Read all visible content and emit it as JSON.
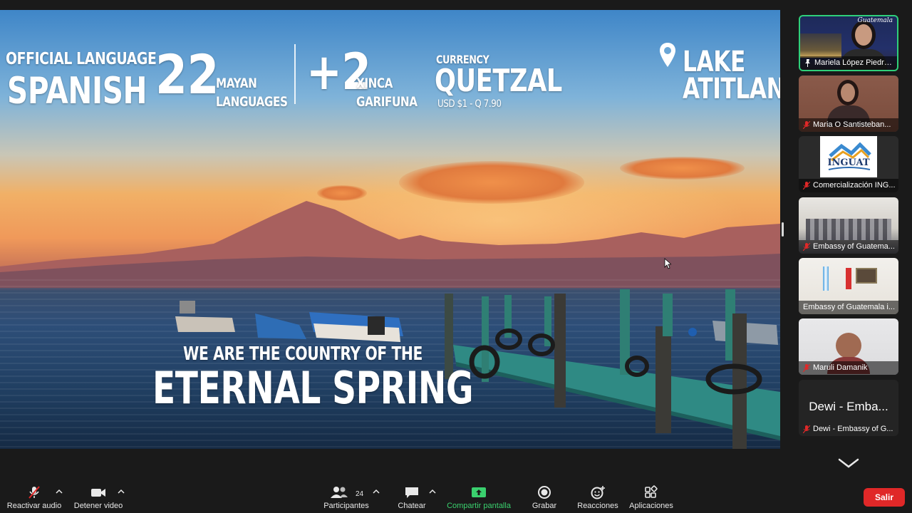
{
  "slide": {
    "official_language_label": "OFFICIAL LANGUAGE",
    "official_language_value": "SPANISH",
    "mayan_count": "22",
    "mayan_line1": "MAYAN",
    "mayan_line2": "LANGUAGES",
    "extra_count": "+2",
    "extra_line1": "XINCA",
    "extra_line2": "GARIFUNA",
    "currency_label": "CURRENCY",
    "currency_value": "QUETZAL",
    "currency_rate": "USD $1 - Q 7.90",
    "lake_line1": "LAKE",
    "lake_line2": "ATITLAN",
    "tagline_small": "WE ARE THE COUNTRY OF THE",
    "tagline_big": "ETERNAL SPRING"
  },
  "participants": [
    {
      "name": "Mariela López Piedra...",
      "pinned": true,
      "mic_muted": false,
      "active": true,
      "tile_overlay": "Guatemala"
    },
    {
      "name": "Maria O Santisteban...",
      "pinned": false,
      "mic_muted": true,
      "active": false
    },
    {
      "name": "Comercialización ING...",
      "pinned": false,
      "mic_muted": true,
      "active": false,
      "logo_text": "INGUAT"
    },
    {
      "name": "Embassy of Guatema...",
      "pinned": false,
      "mic_muted": true,
      "active": false
    },
    {
      "name": "Embassy of Guatemala i...",
      "pinned": false,
      "mic_muted": false,
      "active": false
    },
    {
      "name": "Maruli Damanik",
      "pinned": false,
      "mic_muted": true,
      "active": false
    },
    {
      "name": "Dewi - Embassy of G...",
      "pinned": false,
      "mic_muted": true,
      "active": false,
      "display_name": "Dewi - Emba..."
    }
  ],
  "toolbar": {
    "unmute_label": "Reactivar audio",
    "stop_video_label": "Detener video",
    "participants_label": "Participantes",
    "participants_count": "24",
    "chat_label": "Chatear",
    "share_label": "Compartir pantalla",
    "record_label": "Grabar",
    "reactions_label": "Reacciones",
    "apps_label": "Aplicaciones",
    "leave_label": "Salir"
  },
  "colors": {
    "accent_green": "#3ad06e",
    "leave_red": "#e02828",
    "active_border": "#2fd07a"
  }
}
